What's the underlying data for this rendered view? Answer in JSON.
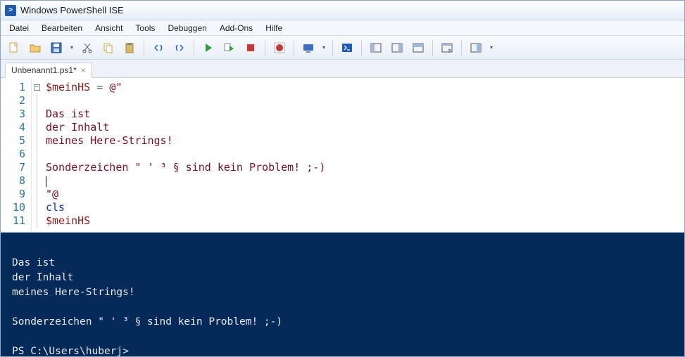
{
  "window": {
    "title": "Windows PowerShell ISE"
  },
  "menu": {
    "items": [
      "Datei",
      "Bearbeiten",
      "Ansicht",
      "Tools",
      "Debuggen",
      "Add-Ons",
      "Hilfe"
    ]
  },
  "toolbar": {
    "icons": [
      "new-file-icon",
      "open-file-icon",
      "save-icon",
      "caret",
      "cut-icon",
      "copy-icon",
      "paste-icon",
      "sep",
      "undo-icon",
      "redo-icon",
      "sep",
      "run-icon",
      "run-selection-icon",
      "stop-icon",
      "sep",
      "breakpoint-icon",
      "sep",
      "remote-icon",
      "caret",
      "sep",
      "powershell-icon",
      "sep",
      "layout-left-icon",
      "layout-right-icon",
      "layout-top-icon",
      "sep",
      "show-script-icon",
      "sep",
      "show-command-icon",
      "caret"
    ]
  },
  "tab": {
    "filename": "Unbenannt1.ps1*"
  },
  "editor": {
    "lines": [
      {
        "n": 1,
        "segments": [
          {
            "t": "$meinHS",
            "c": "tok-var"
          },
          {
            "t": " = ",
            "c": "tok-op"
          },
          {
            "t": "@\"",
            "c": "tok-str"
          }
        ]
      },
      {
        "n": 2,
        "segments": [
          {
            "t": "",
            "c": ""
          }
        ]
      },
      {
        "n": 3,
        "segments": [
          {
            "t": "Das ist",
            "c": "tok-str"
          }
        ]
      },
      {
        "n": 4,
        "segments": [
          {
            "t": "der Inhalt",
            "c": "tok-str"
          }
        ]
      },
      {
        "n": 5,
        "segments": [
          {
            "t": "meines Here-Strings!",
            "c": "tok-str"
          }
        ]
      },
      {
        "n": 6,
        "segments": [
          {
            "t": "",
            "c": ""
          }
        ]
      },
      {
        "n": 7,
        "segments": [
          {
            "t": "Sonderzeichen \" ' ³ § sind kein Problem! ;-)",
            "c": "tok-str"
          }
        ]
      },
      {
        "n": 8,
        "segments": [
          {
            "t": "",
            "c": ""
          }
        ],
        "cursor": true
      },
      {
        "n": 9,
        "segments": [
          {
            "t": "\"@",
            "c": "tok-str"
          }
        ]
      },
      {
        "n": 10,
        "segments": [
          {
            "t": "cls",
            "c": "tok-cmd"
          }
        ]
      },
      {
        "n": 11,
        "segments": [
          {
            "t": "$meinHS",
            "c": "tok-var"
          }
        ]
      }
    ]
  },
  "console": {
    "lines": [
      "",
      "Das ist",
      "der Inhalt",
      "meines Here-Strings!",
      "",
      "Sonderzeichen \" ' ³ § sind kein Problem! ;-)",
      "",
      "PS C:\\Users\\huberj> "
    ]
  }
}
